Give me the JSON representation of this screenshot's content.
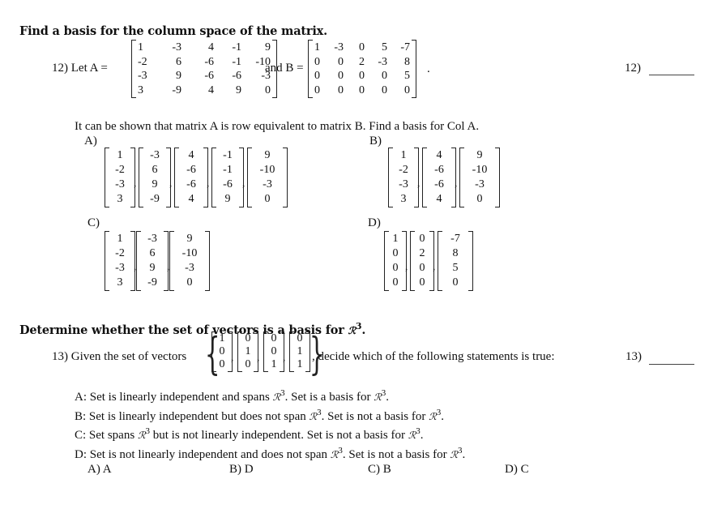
{
  "section1": {
    "heading": "Find a basis for the column space of the matrix.",
    "problem_number": "12)",
    "let_label": "12) Let A =",
    "and_label": "and B =",
    "period": ".",
    "matrix_A": [
      [
        "1",
        "-3",
        "4",
        "-1",
        "9"
      ],
      [
        "-2",
        "6",
        "-6",
        "-1",
        "-10"
      ],
      [
        "-3",
        "9",
        "-6",
        "-6",
        "-3"
      ],
      [
        "3",
        "-9",
        "4",
        "9",
        "0"
      ]
    ],
    "matrix_B": [
      [
        "1",
        "-3",
        "0",
        "5",
        "-7"
      ],
      [
        "0",
        "0",
        "2",
        "-3",
        "8"
      ],
      [
        "0",
        "0",
        "0",
        "0",
        "5"
      ],
      [
        "0",
        "0",
        "0",
        "0",
        "0"
      ]
    ],
    "prompt": "It can be shown that  matrix A is row equivalent to matrix B. Find a basis for Col A.",
    "answer_blank_label": "12)",
    "choices": [
      {
        "label": "A)",
        "vectors": [
          [
            "1",
            "-2",
            "-3",
            "3"
          ],
          [
            "-3",
            "6",
            "9",
            "-9"
          ],
          [
            "4",
            "-6",
            "-6",
            "4"
          ],
          [
            "-1",
            "-1",
            "-6",
            "9"
          ],
          [
            "9",
            "-10",
            "-3",
            "0"
          ]
        ]
      },
      {
        "label": "B)",
        "vectors": [
          [
            "1",
            "-2",
            "-3",
            "3"
          ],
          [
            "4",
            "-6",
            "-6",
            "4"
          ],
          [
            "9",
            "-10",
            "-3",
            "0"
          ]
        ]
      },
      {
        "label": "C)",
        "vectors": [
          [
            "1",
            "-2",
            "-3",
            "3"
          ],
          [
            "-3",
            "6",
            "9",
            "-9"
          ],
          [
            "9",
            "-10",
            "-3",
            "0"
          ]
        ]
      },
      {
        "label": "D)",
        "vectors": [
          [
            "1",
            "0",
            "0",
            "0"
          ],
          [
            "0",
            "2",
            "0",
            "0"
          ],
          [
            "-7",
            "8",
            "5",
            "0"
          ]
        ]
      }
    ]
  },
  "section2": {
    "heading": "Determine whether the set of vectors is a basis for ",
    "R_symbol": "ℛ",
    "R_power": "3",
    "heading_end": ".",
    "given_label": "13) Given the set of vectors",
    "decide_label": ", decide which of the following statements is true:",
    "answer_blank_label": "13)",
    "vectors": [
      [
        "1",
        "0",
        "0"
      ],
      [
        "0",
        "1",
        "0"
      ],
      [
        "0",
        "0",
        "1"
      ],
      [
        "0",
        "1",
        "1"
      ]
    ],
    "statements": [
      {
        "pre": "A: Set is linearly independent and spans ",
        "mid": ". Set  is a basis for ",
        "post": "."
      },
      {
        "pre": "B: Set is linearly independent but does not span ",
        "mid": ". Set is not a basis for ",
        "post": "."
      },
      {
        "pre": "C: Set spans ",
        "mid": " but is not linearly independent. Set is not a basis for ",
        "post": "."
      },
      {
        "pre": "D: Set is not linearly independent and does not span ",
        "mid": ". Set is not a basis for ",
        "post": "."
      }
    ],
    "options": [
      {
        "label": "A) A"
      },
      {
        "label": "B) D"
      },
      {
        "label": "C) B"
      },
      {
        "label": "D) C"
      }
    ]
  }
}
